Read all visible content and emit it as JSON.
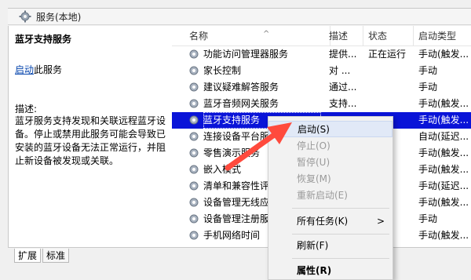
{
  "window": {
    "title": "服务(本地)",
    "icon": "gear-icon"
  },
  "description_panel": {
    "service_name": "蓝牙支持服务",
    "start_link": "启动",
    "start_suffix": "此服务",
    "desc_label": "描述:",
    "desc_text": "蓝牙服务支持发现和关联远程蓝牙设备。停止或禁用此服务可能会导致已安装的蓝牙设备无法正常运行，并阻止新设备被发现或关联。"
  },
  "columns": {
    "name": "名称",
    "description": "描述",
    "status": "状态",
    "startup": "启动类型"
  },
  "rows": [
    {
      "name": "功能访问管理器服务",
      "description": "提供...",
      "status": "正在运行",
      "startup": "手动(触发..."
    },
    {
      "name": "家长控制",
      "description": "对 ...",
      "status": "",
      "startup": "手动"
    },
    {
      "name": "建议疑难解答服务",
      "description": "通过...",
      "status": "",
      "startup": "手动"
    },
    {
      "name": "蓝牙音频网关服务",
      "description": "支持...",
      "status": "",
      "startup": "手动(触发..."
    },
    {
      "name": "蓝牙支持服务",
      "description": "",
      "status": "",
      "startup": "手动(触发..."
    },
    {
      "name": "连接设备平台服务",
      "description": "",
      "status": "",
      "startup": "自动(延迟..."
    },
    {
      "name": "零售演示服务",
      "description": "",
      "status": "",
      "startup": "手动(触发..."
    },
    {
      "name": "嵌入模式",
      "description": "",
      "status": "",
      "startup": "手动(触发..."
    },
    {
      "name": "清单和兼容性评估",
      "description": "",
      "status": "",
      "startup": "手动(延迟..."
    },
    {
      "name": "设备管理无线应用",
      "description": "",
      "status": "",
      "startup": "手动(触发..."
    },
    {
      "name": "设备管理注册服务",
      "description": "",
      "status": "",
      "startup": "手动"
    },
    {
      "name": "手机网络时间",
      "description": "",
      "status": "",
      "startup": "手动(触发..."
    }
  ],
  "tabs": {
    "extended": "扩展",
    "standard": "标准"
  },
  "context_menu": {
    "start": "启动(S)",
    "stop": "停止(O)",
    "pause": "暂停(U)",
    "resume": "恢复(M)",
    "restart": "重新启动(E)",
    "all_tasks": "所有任务(K)",
    "refresh": "刷新(F)",
    "properties": "属性(R)"
  },
  "colors": {
    "selection": "#0a14d8",
    "arrow": "#ff4a3d",
    "link": "#0645ad"
  }
}
